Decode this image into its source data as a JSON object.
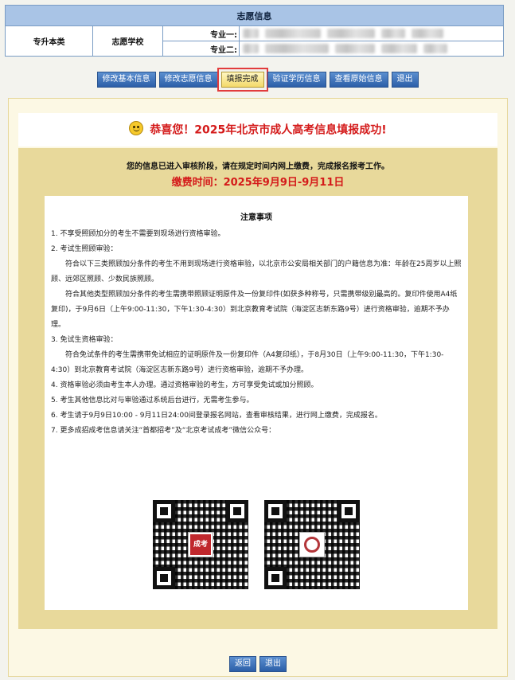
{
  "info": {
    "title": "志愿信息",
    "level": "专升本类",
    "school_label": "志愿学校",
    "major1_label": "专业一:",
    "major2_label": "专业二:"
  },
  "toolbar": {
    "buttons": [
      "修改基本信息",
      "修改志愿信息",
      "填报完成",
      "验证学历信息",
      "查看原始信息",
      "退出"
    ],
    "active": "填报完成"
  },
  "banner": {
    "icon": "smile-icon",
    "headline": "恭喜您！2025年北京市成人高考信息填报成功!"
  },
  "notice": {
    "text": "您的信息已进入审核阶段，请在规定时间内网上缴费，完成报名报考工作。",
    "fee_time": "缴费时间：2025年9月9日-9月11日"
  },
  "notes": {
    "title": "注意事项",
    "lines": [
      "1. 不享受照顾加分的考生不需要到现场进行资格审验。",
      "2. 考试生照顾审验：",
      "符合以下三类照顾加分条件的考生不用到现场进行资格审验，以北京市公安局相关部门的户籍信息为准：年龄在25周岁以上照顾、远郊区照顾、少数民族照顾。",
      "符合其他类型照顾加分条件的考生需携带照顾证明原件及一份复印件(如获多种称号，只需携带级别最高的。复印件使用A4纸复印)，于9月6日（上午9:00-11:30，下午1:30-4:30）到北京教育考试院（海淀区志新东路9号）进行资格审验，逾期不予办理。",
      "3. 免试生资格审验：",
      "符合免试条件的考生需携带免试相应的证明原件及一份复印件（A4复印纸），于8月30日（上午9:00-11:30，下午1:30-4:30）到北京教育考试院（海淀区志新东路9号）进行资格审验，逾期不予办理。",
      "4. 资格审验必须由考生本人办理。通过资格审验的考生，方可享受免试或加分照顾。",
      "5. 考生其他信息比对与审验通过系统后台进行，无需考生参与。",
      "6. 考生请于9月9日10:00 - 9月11日24:00间登录报名网站，查看审核结果，进行网上缴费，完成报名。",
      "7. 更多成招成考信息请关注“首都招考”及“北京考试成考”微信公众号："
    ]
  },
  "qr": {
    "left_logo": "成考",
    "left_icon": "qr-code-icon",
    "right_icon": "qr-code-icon"
  },
  "footer": {
    "back_label": "返回",
    "exit_label": "退出"
  }
}
